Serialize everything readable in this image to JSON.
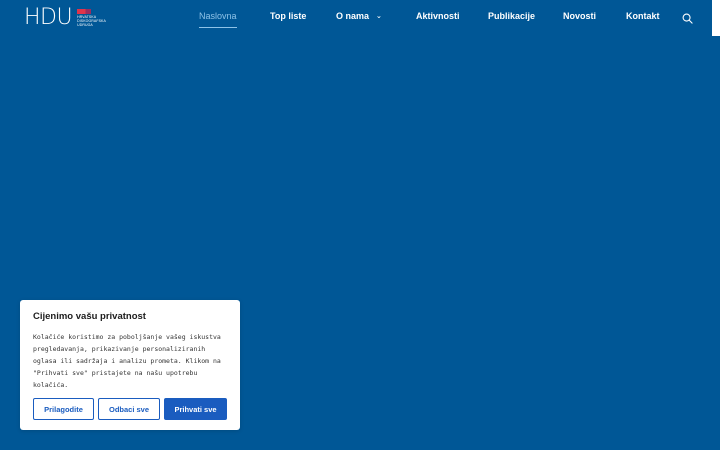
{
  "header": {
    "logo": {
      "mark": "HDU",
      "subtitle": "HRVATSKA\nDISKOGRAFSKA\nUDRUGA"
    },
    "nav": [
      {
        "label": "Naslovna",
        "active": true
      },
      {
        "label": "Top liste",
        "active": false
      },
      {
        "label": "O nama",
        "active": false,
        "has_dropdown": true
      },
      {
        "label": "Aktivnosti",
        "active": false
      },
      {
        "label": "Publikacije",
        "active": false
      },
      {
        "label": "Novosti",
        "active": false
      },
      {
        "label": "Kontakt",
        "active": false
      }
    ],
    "search_icon": "search-icon"
  },
  "cookie_banner": {
    "title": "Cijenimo vašu privatnost",
    "text": "Kolačiće koristimo za poboljšanje vašeg iskustva pregledavanja, prikazivanje personaliziranih oglasa ili sadržaja i analizu prometa. Klikom na \"Prihvati sve\" pristajete na našu upotrebu kolačića.",
    "buttons": {
      "customize": "Prilagodite",
      "reject": "Odbaci sve",
      "accept": "Prihvati sve"
    }
  },
  "colors": {
    "background": "#005796",
    "accent": "#1a5cbf",
    "nav_active": "#8ec3e8",
    "logo_flag": "#e0354b"
  }
}
